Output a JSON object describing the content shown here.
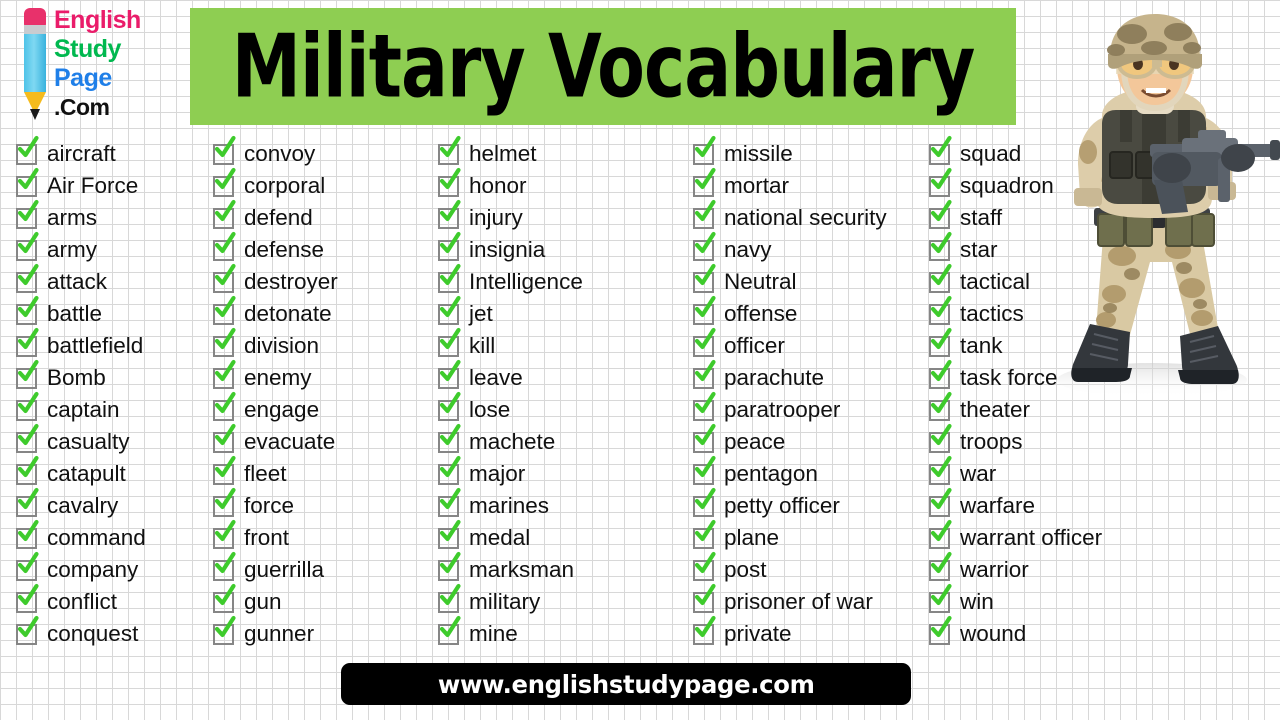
{
  "logo": {
    "line1": "English",
    "line2": "Study",
    "line3": "Page",
    "line4": ".Com",
    "colors": {
      "line1": "#ea1c6a",
      "line2": "#00b84f",
      "line3": "#1f7fe8",
      "line4": "#111111"
    },
    "icon": "pencil-icon"
  },
  "banner": {
    "title": "Military Vocabulary",
    "background_color": "#8ece52",
    "text_color": "#000000"
  },
  "illustration": {
    "name": "soldier-illustration",
    "description": "cartoon soldier in desert camouflage holding a rifle"
  },
  "checkbox": {
    "state": "checked",
    "check_color": "#3ecb2c",
    "box_border_color": "#868686"
  },
  "columns": [
    {
      "index": 0,
      "words": [
        "aircraft",
        "Air Force",
        "arms",
        "army",
        "attack",
        "battle",
        "battlefield",
        "Bomb",
        "captain",
        "casualty",
        "catapult",
        "cavalry",
        "command",
        "company",
        "conflict",
        "conquest"
      ]
    },
    {
      "index": 1,
      "words": [
        "convoy",
        "corporal",
        "defend",
        "defense",
        "destroyer",
        "detonate",
        "division",
        "enemy",
        "engage",
        "evacuate",
        "fleet",
        "force",
        "front",
        "guerrilla",
        "gun",
        "gunner"
      ]
    },
    {
      "index": 2,
      "words": [
        "helmet",
        "honor",
        "injury",
        "insignia",
        "Intelligence",
        "jet",
        "kill",
        "leave",
        "lose",
        "machete",
        "major",
        "marines",
        "medal",
        "marksman",
        "military",
        "mine"
      ]
    },
    {
      "index": 3,
      "words": [
        "missile",
        "mortar",
        "national security",
        "navy",
        "Neutral",
        "offense",
        "officer",
        "parachute",
        "paratrooper",
        "peace",
        "pentagon",
        "petty officer",
        "plane",
        "post",
        "prisoner of war",
        "private"
      ]
    },
    {
      "index": 4,
      "words": [
        "squad",
        "squadron",
        "staff",
        "star",
        "tactical",
        "tactics",
        "tank",
        "task force",
        "theater",
        "troops",
        "war",
        "warfare",
        "warrant officer",
        "warrior",
        "win",
        "wound"
      ]
    }
  ],
  "footer": {
    "url": "www.englishstudypage.com",
    "background_color": "#000000",
    "text_color": "#ffffff"
  }
}
